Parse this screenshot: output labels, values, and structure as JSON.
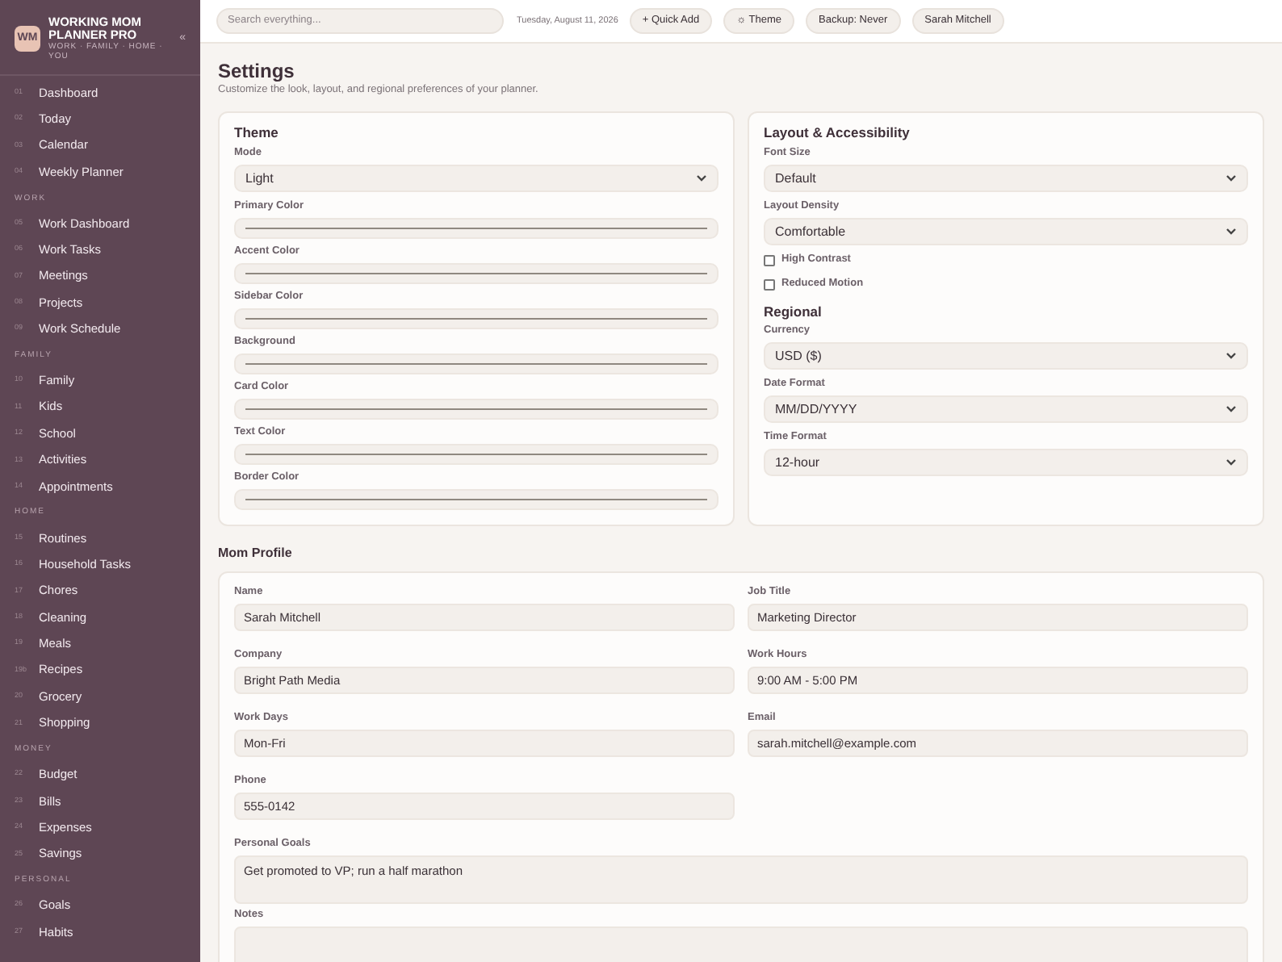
{
  "brand": {
    "logo": "WM",
    "title": "WORKING MOM PLANNER PRO",
    "tagline": "WORK · FAMILY · HOME · YOU",
    "collapse": "«"
  },
  "sidebar": {
    "sections": [
      {
        "items": [
          {
            "num": "01",
            "label": "Dashboard",
            "selected": false
          },
          {
            "num": "02",
            "label": "Today",
            "selected": false
          },
          {
            "num": "03",
            "label": "Calendar",
            "selected": false
          },
          {
            "num": "04",
            "label": "Weekly Planner",
            "selected": false
          }
        ]
      },
      {
        "title": "WORK",
        "items": [
          {
            "num": "05",
            "label": "Work Dashboard",
            "selected": false
          },
          {
            "num": "06",
            "label": "Work Tasks",
            "selected": false
          },
          {
            "num": "07",
            "label": "Meetings",
            "selected": false
          },
          {
            "num": "08",
            "label": "Projects",
            "selected": false
          },
          {
            "num": "09",
            "label": "Work Schedule",
            "selected": false
          }
        ]
      },
      {
        "title": "FAMILY",
        "items": [
          {
            "num": "10",
            "label": "Family",
            "selected": false
          },
          {
            "num": "11",
            "label": "Kids",
            "selected": false
          },
          {
            "num": "12",
            "label": "School",
            "selected": false
          },
          {
            "num": "13",
            "label": "Activities",
            "selected": false
          },
          {
            "num": "14",
            "label": "Appointments",
            "selected": false
          }
        ]
      },
      {
        "title": "HOME",
        "items": [
          {
            "num": "15",
            "label": "Routines",
            "selected": false
          },
          {
            "num": "16",
            "label": "Household Tasks",
            "selected": false
          },
          {
            "num": "17",
            "label": "Chores",
            "selected": false
          },
          {
            "num": "18",
            "label": "Cleaning",
            "selected": false
          },
          {
            "num": "19",
            "label": "Meals",
            "selected": false
          },
          {
            "num": "19b",
            "label": "Recipes",
            "selected": false
          },
          {
            "num": "20",
            "label": "Grocery",
            "selected": false
          },
          {
            "num": "21",
            "label": "Shopping",
            "selected": false
          }
        ]
      },
      {
        "title": "MONEY",
        "items": [
          {
            "num": "22",
            "label": "Budget",
            "selected": false
          },
          {
            "num": "23",
            "label": "Bills",
            "selected": false
          },
          {
            "num": "24",
            "label": "Expenses",
            "selected": false
          },
          {
            "num": "25",
            "label": "Savings",
            "selected": false
          }
        ]
      },
      {
        "title": "PERSONAL",
        "items": [
          {
            "num": "26",
            "label": "Goals",
            "selected": false
          },
          {
            "num": "27",
            "label": "Habits",
            "selected": false
          }
        ]
      }
    ]
  },
  "topbar": {
    "search": {
      "placeholder": "Search everything..."
    },
    "date": "Tuesday, August 11, 2026",
    "buttons": [
      "+ Quick Add",
      "☼ Theme",
      "Backup: Never",
      "Sarah Mitchell"
    ]
  },
  "page": {
    "title": "Settings",
    "subtitle": "Customize the look, layout, and regional preferences of your planner."
  },
  "theme": {
    "title": "Theme",
    "fields": [
      {
        "kind": "select",
        "label": "Mode",
        "value": "Light"
      },
      {
        "kind": "color",
        "label": "Primary Color"
      },
      {
        "kind": "color",
        "label": "Accent Color"
      },
      {
        "kind": "color",
        "label": "Sidebar Color"
      },
      {
        "kind": "color",
        "label": "Background"
      },
      {
        "kind": "color",
        "label": "Card Color"
      },
      {
        "kind": "color",
        "label": "Text Color"
      },
      {
        "kind": "color",
        "label": "Border Color"
      }
    ]
  },
  "layout": {
    "title": "Layout & Accessibility",
    "fields": [
      {
        "kind": "select",
        "label": "Font Size",
        "value": "Default"
      },
      {
        "kind": "select",
        "label": "Layout Density",
        "value": "Comfortable"
      },
      {
        "kind": "checkbox",
        "label": "High Contrast",
        "checked": false
      },
      {
        "kind": "checkbox",
        "label": "Reduced Motion",
        "checked": false
      }
    ]
  },
  "regional": {
    "title": "Regional",
    "fields": [
      {
        "kind": "select",
        "label": "Currency",
        "value": "USD ($)"
      },
      {
        "kind": "select",
        "label": "Date Format",
        "value": "MM/DD/YYYY"
      },
      {
        "kind": "select",
        "label": "Time Format",
        "value": "12-hour"
      }
    ]
  },
  "profile": {
    "title": "Mom Profile",
    "fields": [
      {
        "kind": "text",
        "label": "Name",
        "value": "Sarah Mitchell"
      },
      {
        "kind": "text",
        "label": "Job Title",
        "value": "Marketing Director"
      },
      {
        "kind": "text",
        "label": "Company",
        "value": "Bright Path Media"
      },
      {
        "kind": "text",
        "label": "Work Hours",
        "value": "9:00 AM - 5:00 PM"
      },
      {
        "kind": "text",
        "label": "Work Days",
        "value": "Mon-Fri"
      },
      {
        "kind": "text",
        "label": "Email",
        "value": "sarah.mitchell@example.com"
      },
      {
        "kind": "text",
        "label": "Phone",
        "value": "555-0142"
      },
      {
        "kind": "textarea",
        "label": "Personal Goals",
        "value": "Get promoted to VP; run a half marathon"
      },
      {
        "kind": "textarea",
        "label": "Notes"
      }
    ]
  }
}
